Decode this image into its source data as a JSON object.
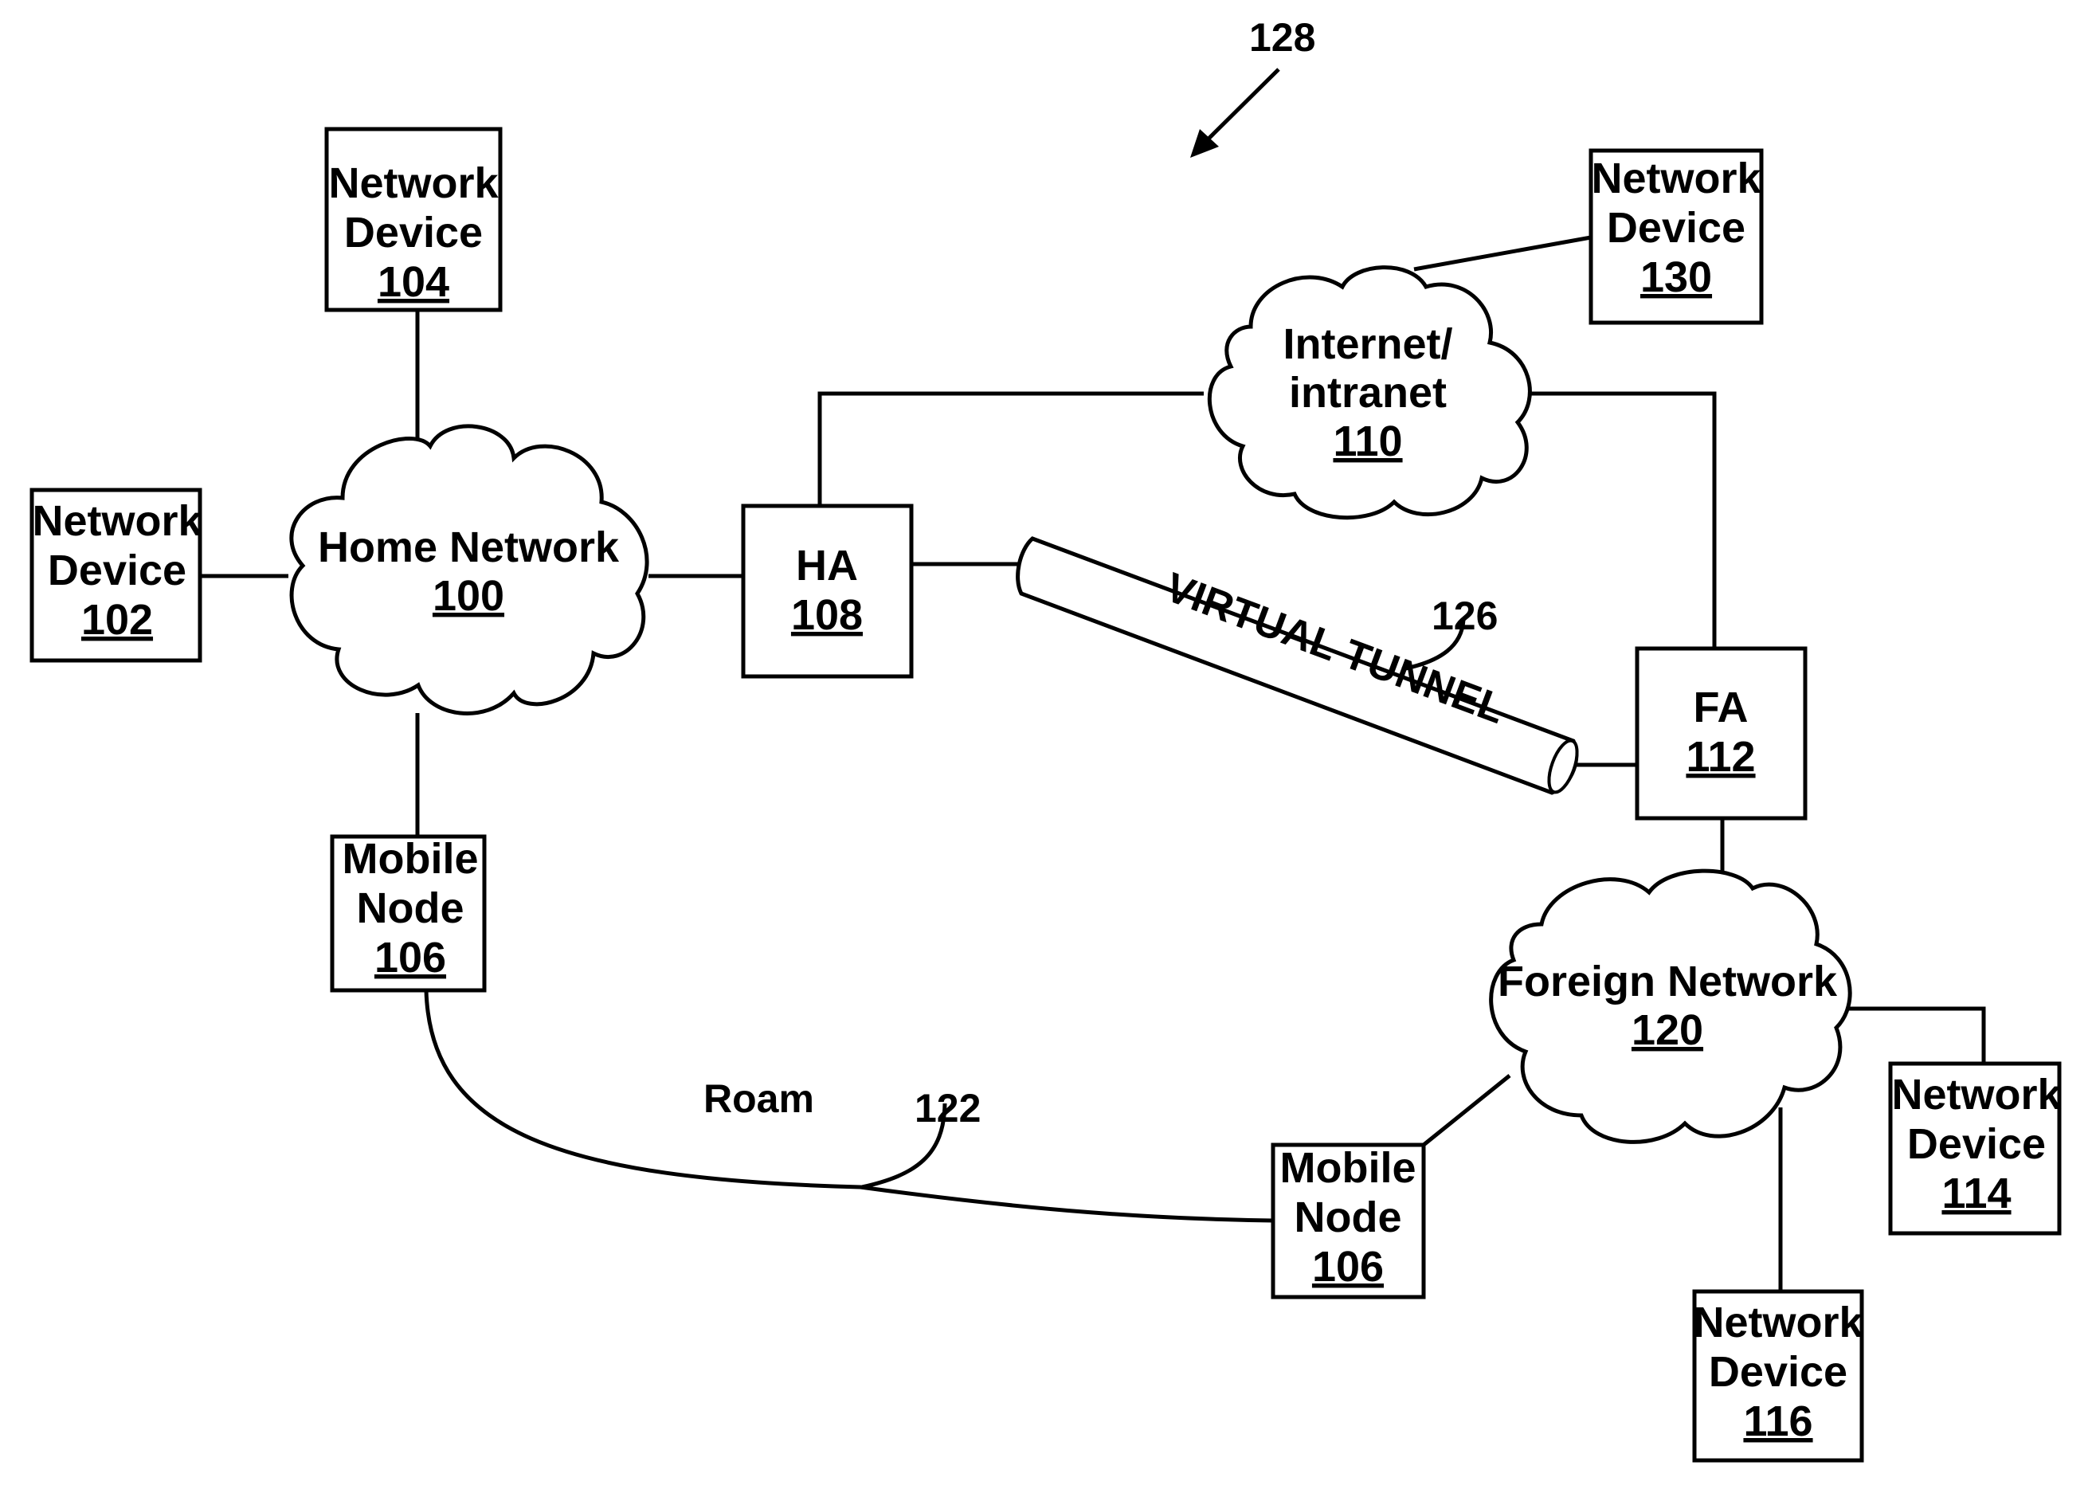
{
  "figure": {
    "reference": "128",
    "nodes": {
      "nd104": {
        "line1": "Network",
        "line2": "Device",
        "num": "104"
      },
      "nd102": {
        "line1": "Network",
        "line2": "Device",
        "num": "102"
      },
      "nd130": {
        "line1": "Network",
        "line2": "Device",
        "num": "130"
      },
      "nd114": {
        "line1": "Network",
        "line2": "Device",
        "num": "114"
      },
      "nd116": {
        "line1": "Network",
        "line2": "Device",
        "num": "116"
      },
      "ha": {
        "line1": "HA",
        "num": "108"
      },
      "fa": {
        "line1": "FA",
        "num": "112"
      },
      "mn_home": {
        "line1": "Mobile",
        "line2": "Node",
        "num": "106"
      },
      "mn_foreign": {
        "line1": "Mobile",
        "line2": "Node",
        "num": "106"
      }
    },
    "clouds": {
      "home": {
        "line1": "Home Network",
        "num": "100"
      },
      "internet": {
        "line1": "Internet/",
        "line2": "intranet",
        "num": "110"
      },
      "foreign": {
        "line1": "Foreign Network",
        "num": "120"
      }
    },
    "tunnel": {
      "label": "VIRTUAL TUNNEL",
      "ref": "126"
    },
    "roam": {
      "label": "Roam",
      "ref": "122"
    }
  }
}
